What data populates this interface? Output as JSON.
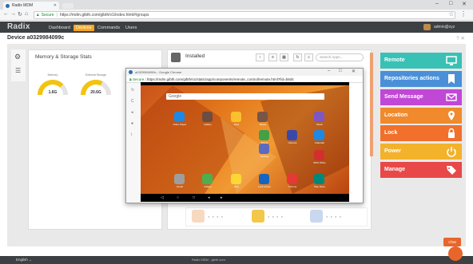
{
  "browser": {
    "tab_title": "Radix MDM",
    "secure_label": "Secure",
    "url": "https://mdm.gibth.com/gibth/v1/index.html#/groups"
  },
  "app": {
    "logo": "Radix",
    "nav": [
      "Dashboard",
      "Devices",
      "Commands",
      "Users"
    ],
    "active_nav": "Devices",
    "admin_label": "admin@xyz"
  },
  "device": {
    "title": "Device a0329984099c",
    "header_icons": "? ✕"
  },
  "memory": {
    "title": "Memory & Storage Stats",
    "gauges": [
      {
        "label": "Memory",
        "value": "1.6G",
        "fill": 0.75
      },
      {
        "label": "External Storage",
        "value": "20.6G",
        "fill": 0.65
      }
    ]
  },
  "installed": {
    "title": "Installed",
    "search_placeholder": "Search Apps..."
  },
  "popup": {
    "title": "a0329984099c - Google Chrome",
    "secure_label": "Secure",
    "url": "https://mdm.gibth.com/gibth/v1/static/app/components/remote_control/remote.html?fid=b9d4"
  },
  "android": {
    "search_placeholder": "Google",
    "apps": [
      {
        "label": "Video Player",
        "color": "#1e88e5"
      },
      {
        "label": "Gallery",
        "color": "#6d4c41"
      },
      {
        "label": "Files",
        "color": "#fbc02d"
      },
      {
        "label": "Books",
        "color": "#795548"
      },
      {
        "label": "Music",
        "color": "#7e57c2"
      },
      {
        "label": "Phone",
        "color": "#43a047"
      },
      {
        "label": "Camera",
        "color": "#3949ab"
      },
      {
        "label": "Calendar",
        "color": "#1e88e5"
      },
      {
        "label": "Settings",
        "color": "#5c6bc0"
      },
      {
        "label": "WPS Office",
        "color": "#d32f2f"
      },
      {
        "label": "Email",
        "color": "#9e9e9e"
      },
      {
        "label": "Gallery",
        "color": "#4caf50"
      },
      {
        "label": "Files",
        "color": "#fdd835"
      },
      {
        "label": "Lock screen",
        "color": "#1565c0"
      },
      {
        "label": "Chrome",
        "color": "#e53935"
      },
      {
        "label": "Play Store",
        "color": "#00897b"
      }
    ]
  },
  "actions": [
    {
      "label": "Remote",
      "color": "#39c1b5",
      "icon": "monitor-icon"
    },
    {
      "label": "Repositories actions",
      "color": "#4a90d9",
      "icon": "bookmark-icon"
    },
    {
      "label": "Send Message",
      "color": "#c147d6",
      "icon": "envelope-icon"
    },
    {
      "label": "Location",
      "color": "#f08a2c",
      "icon": "pin-icon"
    },
    {
      "label": "Lock",
      "color": "#f0702c",
      "icon": "lock-icon"
    },
    {
      "label": "Power",
      "color": "#f2b22a",
      "icon": "power-icon"
    },
    {
      "label": "Manage",
      "color": "#e84848",
      "icon": "tag-icon"
    }
  ],
  "footer": {
    "language": "English ⌄",
    "center_text": "Radix MDM - gibth.com"
  },
  "chat": {
    "button": "Chat"
  }
}
